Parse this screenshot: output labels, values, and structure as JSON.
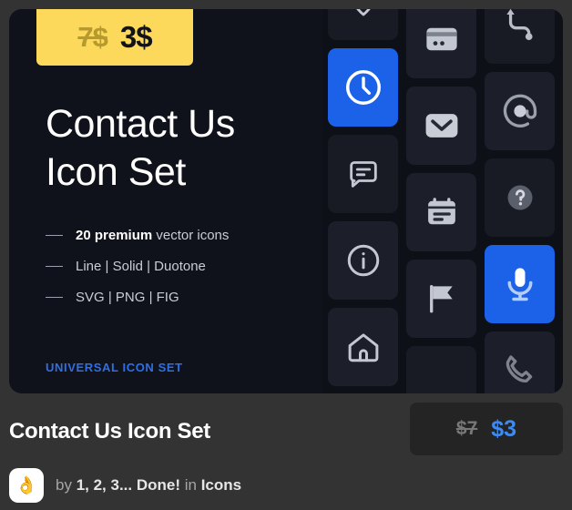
{
  "card": {
    "promo_badge": {
      "old_price": "7$",
      "new_price": "3$"
    },
    "headline_line1": "Contact Us",
    "headline_line2": "Icon Set",
    "features": [
      {
        "strong": "20 premium",
        "rest": " vector icons"
      },
      {
        "strong": "",
        "rest": "Line | Solid | Duotone"
      },
      {
        "strong": "",
        "rest": "SVG | PNG | FIG"
      }
    ],
    "brand_label": "UNIVERSAL ICON SET",
    "icon_grid": {
      "columns": [
        [
          {
            "icon": "location-pin-icon",
            "style": "line",
            "active": false
          },
          {
            "icon": "clock-icon",
            "style": "line",
            "active": true
          },
          {
            "icon": "chat-bubble-icon",
            "style": "line",
            "active": false
          },
          {
            "icon": "info-circle-icon",
            "style": "line",
            "active": false
          },
          {
            "icon": "home-icon",
            "style": "line",
            "active": false
          }
        ],
        [
          {
            "icon": "credit-card-icon",
            "style": "solid",
            "active": false
          },
          {
            "icon": "envelope-icon",
            "style": "solid",
            "active": false
          },
          {
            "icon": "notes-icon",
            "style": "solid",
            "active": false
          },
          {
            "icon": "flag-icon",
            "style": "solid",
            "active": false
          },
          {
            "icon": "blank-tile",
            "style": "none",
            "active": false
          }
        ],
        [
          {
            "icon": "route-icon",
            "style": "duotone",
            "active": false
          },
          {
            "icon": "at-sign-icon",
            "style": "duotone",
            "active": false
          },
          {
            "icon": "question-circle-icon",
            "style": "duotone",
            "active": false
          },
          {
            "icon": "microphone-icon",
            "style": "duotone",
            "active": true
          },
          {
            "icon": "phone-icon",
            "style": "duotone",
            "active": false
          }
        ]
      ]
    }
  },
  "meta": {
    "title": "Contact Us Icon Set",
    "price": {
      "old": "$7",
      "new": "$3"
    },
    "author": {
      "avatar_emoji": "👌",
      "prefix": "by ",
      "name": "1, 2, 3... Done!",
      "middle": " in ",
      "category": "Icons"
    }
  },
  "colors": {
    "page_bg": "#333333",
    "card_bg": "#10121b",
    "accent_blue": "#1b62e8",
    "link_blue": "#3d8bf2",
    "promo_yellow": "#fcd95b"
  }
}
